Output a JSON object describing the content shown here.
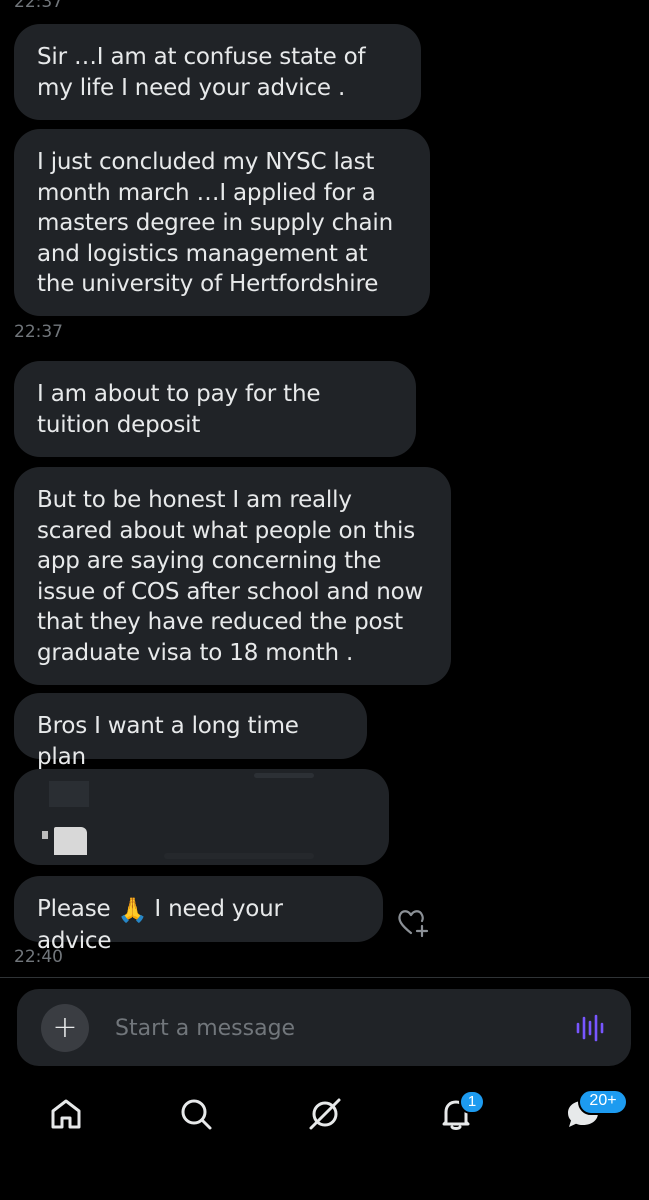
{
  "status_bar": {
    "time_partial": "22:37"
  },
  "messages": [
    {
      "text": "Sir …I am at confuse state of my life I need your advice ."
    },
    {
      "text": "I just concluded my NYSC last month march …I applied for a masters degree in supply chain and logistics management at the university of Hertfordshire"
    },
    {
      "text": "I am about to pay for the tuition deposit"
    },
    {
      "text": "But to be honest I am really scared about what people on this app are saying concerning the issue of COS after school and now that they have reduced the post graduate visa to 18 month ."
    },
    {
      "text": "Bros I want a long time plan"
    },
    {
      "text": ""
    },
    {
      "text_before": "Please",
      "emoji": "🙏",
      "text_after": "I need your advice"
    }
  ],
  "timestamps": {
    "first": "22:37",
    "second": "22:40"
  },
  "composer": {
    "placeholder": "Start a message",
    "plus_label": "+"
  },
  "nav": {
    "items": [
      "home-icon",
      "search-icon",
      "grok-icon",
      "notifications-icon",
      "messages-icon"
    ],
    "notifications_badge": "1",
    "messages_badge": "20+"
  },
  "colors": {
    "background": "#000000",
    "bubble": "#202327",
    "text": "#e7e9ea",
    "muted": "#71767b",
    "accent": "#1d9bf0",
    "voice_accent": "#7856ff"
  }
}
